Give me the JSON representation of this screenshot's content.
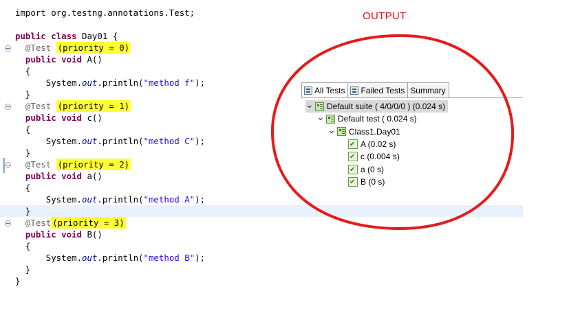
{
  "editor": {
    "lines": [
      {
        "parts": [
          {
            "t": "import org.testng.annotations.Test;",
            "c": ""
          }
        ]
      },
      {
        "parts": []
      },
      {
        "parts": [
          {
            "t": "public class ",
            "c": "kw"
          },
          {
            "t": "Day01 {",
            "c": ""
          }
        ]
      },
      {
        "parts": [
          {
            "t": "  @Test ",
            "c": "ann"
          },
          {
            "t": "(priority = 0)",
            "c": "hl"
          }
        ]
      },
      {
        "parts": [
          {
            "t": "  public void ",
            "c": "kw"
          },
          {
            "t": "A()",
            "c": ""
          }
        ]
      },
      {
        "parts": [
          {
            "t": "  {",
            "c": ""
          }
        ]
      },
      {
        "parts": [
          {
            "t": "      System.",
            "c": ""
          },
          {
            "t": "out",
            "c": "it"
          },
          {
            "t": ".println(",
            "c": ""
          },
          {
            "t": "\"method f\"",
            "c": "str"
          },
          {
            "t": ");",
            "c": ""
          }
        ]
      },
      {
        "parts": [
          {
            "t": "  }",
            "c": ""
          }
        ]
      },
      {
        "parts": [
          {
            "t": "  @Test ",
            "c": "ann"
          },
          {
            "t": "(priority = 1)",
            "c": "hl"
          }
        ]
      },
      {
        "parts": [
          {
            "t": "  public void ",
            "c": "kw"
          },
          {
            "t": "c()",
            "c": ""
          }
        ]
      },
      {
        "parts": [
          {
            "t": "  {",
            "c": ""
          }
        ]
      },
      {
        "parts": [
          {
            "t": "      System.",
            "c": ""
          },
          {
            "t": "out",
            "c": "it"
          },
          {
            "t": ".println(",
            "c": ""
          },
          {
            "t": "\"method C\"",
            "c": "str"
          },
          {
            "t": ");",
            "c": ""
          }
        ]
      },
      {
        "parts": [
          {
            "t": "  }",
            "c": ""
          }
        ]
      },
      {
        "parts": [
          {
            "t": "  @Test ",
            "c": "ann"
          },
          {
            "t": "(priority = 2)",
            "c": "hl"
          }
        ]
      },
      {
        "parts": [
          {
            "t": "  public void ",
            "c": "kw"
          },
          {
            "t": "a()",
            "c": ""
          }
        ]
      },
      {
        "parts": [
          {
            "t": "  {",
            "c": ""
          }
        ]
      },
      {
        "parts": [
          {
            "t": "      System.",
            "c": ""
          },
          {
            "t": "out",
            "c": "it"
          },
          {
            "t": ".println(",
            "c": ""
          },
          {
            "t": "\"method A\"",
            "c": "str"
          },
          {
            "t": ");",
            "c": ""
          }
        ]
      },
      {
        "parts": [
          {
            "t": "  }",
            "c": ""
          }
        ],
        "current": true
      },
      {
        "parts": [
          {
            "t": "  @Test",
            "c": "ann"
          },
          {
            "t": "(priority = 3)",
            "c": "hl"
          }
        ]
      },
      {
        "parts": [
          {
            "t": "  public void ",
            "c": "kw"
          },
          {
            "t": "B()",
            "c": ""
          }
        ]
      },
      {
        "parts": [
          {
            "t": "  {",
            "c": ""
          }
        ]
      },
      {
        "parts": [
          {
            "t": "      System.",
            "c": ""
          },
          {
            "t": "out",
            "c": "it"
          },
          {
            "t": ".println(",
            "c": ""
          },
          {
            "t": "\"method B\"",
            "c": "str"
          },
          {
            "t": ");",
            "c": ""
          }
        ]
      },
      {
        "parts": [
          {
            "t": "  }",
            "c": ""
          }
        ]
      },
      {
        "parts": [
          {
            "t": "}",
            "c": ""
          }
        ]
      }
    ]
  },
  "annotation": {
    "output_label": "OUTPUT",
    "ellipse_color": "#e51b1b"
  },
  "results_panel": {
    "tabs": [
      {
        "label": "All Tests",
        "icon": "test-tree-icon",
        "active": true
      },
      {
        "label": "Failed Tests",
        "icon": "failed-tests-icon",
        "active": false
      },
      {
        "label": "Summary",
        "icon": "",
        "active": false
      }
    ],
    "tree": [
      {
        "label": "Default suite ( 4/0/0/0 ) (0.024 s)",
        "level": 0,
        "expanded": true,
        "selected": true,
        "icon": "suite-icon"
      },
      {
        "label": "Default test ( 0.024 s)",
        "level": 1,
        "expanded": true,
        "selected": false,
        "icon": "test-icon"
      },
      {
        "label": "Class1.Day01",
        "level": 2,
        "expanded": true,
        "selected": false,
        "icon": "class-icon"
      },
      {
        "label": "A  (0.02 s)",
        "level": 3,
        "expanded": null,
        "selected": false,
        "icon": "passed-method-icon"
      },
      {
        "label": "c  (0.004 s)",
        "level": 3,
        "expanded": null,
        "selected": false,
        "icon": "passed-method-icon"
      },
      {
        "label": "a  (0 s)",
        "level": 3,
        "expanded": null,
        "selected": false,
        "icon": "passed-method-icon"
      },
      {
        "label": "B  (0 s)",
        "level": 3,
        "expanded": null,
        "selected": false,
        "icon": "passed-method-icon"
      }
    ]
  }
}
